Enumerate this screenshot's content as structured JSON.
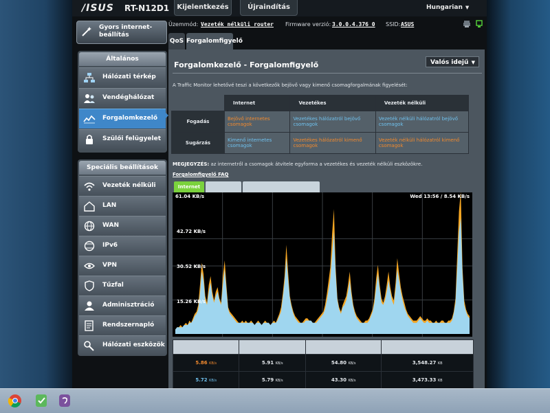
{
  "header": {
    "brand": "/ISUS",
    "model": "RT-N12D1",
    "logout_label": "Kijelentkezés",
    "reboot_label": "Újraindítás",
    "language": "Hungarian"
  },
  "sidebar": {
    "quick_setup": "Gyors internet-beállítás",
    "general_title": "Általános",
    "general_items": [
      {
        "label": "Hálózati térkép",
        "icon": "network-map-icon"
      },
      {
        "label": "Vendéghálózat",
        "icon": "guest-network-icon"
      },
      {
        "label": "Forgalomkezelő",
        "icon": "traffic-manager-icon",
        "active": true
      },
      {
        "label": "Szülői felügyelet",
        "icon": "parental-control-icon"
      }
    ],
    "advanced_title": "Speciális beállítások",
    "advanced_items": [
      {
        "label": "Vezeték nélküli",
        "icon": "wireless-icon"
      },
      {
        "label": "LAN",
        "icon": "lan-icon"
      },
      {
        "label": "WAN",
        "icon": "wan-icon"
      },
      {
        "label": "IPv6",
        "icon": "ipv6-icon"
      },
      {
        "label": "VPN",
        "icon": "vpn-icon"
      },
      {
        "label": "Tűzfal",
        "icon": "firewall-icon"
      },
      {
        "label": "Adminisztráció",
        "icon": "administration-icon"
      },
      {
        "label": "Rendszernapló",
        "icon": "system-log-icon"
      },
      {
        "label": "Hálózati eszközök",
        "icon": "network-tools-icon"
      }
    ]
  },
  "info": {
    "mode_label": "Üzemmód:",
    "mode_value": "Vezeték nélküli router",
    "firmware_label": "Firmware verzió:",
    "firmware_value": "3.0.0.4.376_0",
    "ssid_label": "SSID:",
    "ssid_value": "ASUS"
  },
  "tabs": [
    {
      "label": "QoS"
    },
    {
      "label": "Forgalomfigyelő",
      "selected": true
    }
  ],
  "page": {
    "title": "Forgalomkezelő - Forgalomfigyelő",
    "view_select": "Valós idejű",
    "description": "A Traffic Monitor lehetővé teszi a következők bejövő vagy kimenő csomagforgalmának figyelését:",
    "note_label": "MEGJEGYZÉS:",
    "note_text": " az internetről a csomagok átvitele egyforma a vezetékes és vezeték nélküli eszközökre.",
    "faq_link": "Forgalomfigyelő FAQ"
  },
  "matrix": {
    "headers": [
      "Internet",
      "Vezetékes",
      "Vezeték nélküli"
    ],
    "rows": [
      {
        "label": "Fogadás",
        "cells": [
          "Bejövő internetes csomagok",
          "Vezetékes hálózatról bejövő csomagok",
          "Vezeték nélküli hálózatról bejövő csomagok"
        ]
      },
      {
        "label": "Sugárzás",
        "cells": [
          "Kimenő internetes csomagok",
          "Vezetékes hálózatról kimenő csomagok",
          "Vezeték nélküli hálózatról kimenő csomagok"
        ]
      }
    ]
  },
  "graph_tabs": [
    {
      "label": "Internet",
      "selected": true
    },
    {
      "label": ""
    },
    {
      "label": ""
    }
  ],
  "graph": {
    "y_max_label": "61.04 KB/s",
    "y_ticks": [
      "42.72 KB/s",
      "30.52 KB/s",
      "15.26 KB/s"
    ],
    "timestamp": "Wed 13:56 / 8.54 KB/s",
    "inbound_color": "#f5a623",
    "outbound_color": "#9fd6ef"
  },
  "chart_data": {
    "type": "area",
    "title": "",
    "ylabel": "",
    "ylim": [
      0,
      61.04
    ],
    "y_ticks": [
      "15.26 KB/s",
      "30.52 KB/s",
      "42.72 KB/s",
      "61.04 KB/s"
    ],
    "series": [
      {
        "values": [
          2,
          3,
          3,
          4,
          3,
          4,
          5,
          4,
          6,
          5,
          7,
          9,
          10,
          13,
          22,
          32,
          27,
          17,
          14,
          22,
          26,
          19,
          15,
          19,
          21,
          16,
          14,
          26,
          33,
          22,
          12,
          10,
          9,
          8,
          7,
          6,
          5,
          5,
          6,
          5,
          6,
          5,
          5,
          6,
          5,
          4,
          5,
          6,
          5,
          4,
          5,
          6,
          5,
          5,
          4,
          5,
          6,
          5,
          7,
          9,
          12,
          18,
          26,
          40,
          28,
          17,
          13,
          10,
          8,
          7,
          6,
          5,
          5,
          6,
          7,
          7,
          6,
          6,
          5,
          5,
          6,
          7,
          8,
          9,
          10,
          13,
          18,
          24,
          30,
          45,
          56,
          30,
          16,
          12,
          10,
          13,
          15,
          17,
          22,
          28,
          19,
          13,
          10,
          8,
          7,
          6,
          5,
          5,
          6,
          6,
          7,
          9,
          11,
          16,
          25,
          31,
          22,
          16,
          14,
          17,
          22,
          28,
          21,
          17,
          15,
          23,
          34,
          27,
          21,
          17,
          14,
          11,
          9,
          8,
          7,
          6,
          6,
          6,
          7,
          8,
          7,
          6,
          6,
          7,
          6,
          6,
          5,
          5,
          6,
          5,
          5,
          6,
          6,
          5,
          5,
          6,
          6,
          7,
          10,
          16,
          36,
          55,
          64,
          30,
          15,
          11,
          9,
          8
        ]
      },
      {
        "values": [
          2,
          3,
          3,
          3,
          3,
          4,
          4,
          4,
          5,
          5,
          6,
          8,
          9,
          11,
          18,
          28,
          24,
          15,
          13,
          19,
          23,
          17,
          14,
          17,
          19,
          15,
          13,
          22,
          29,
          20,
          11,
          9,
          8,
          7,
          6,
          5,
          5,
          5,
          5,
          5,
          5,
          5,
          5,
          5,
          5,
          4,
          5,
          5,
          5,
          4,
          5,
          5,
          5,
          5,
          4,
          5,
          5,
          5,
          6,
          8,
          10,
          16,
          23,
          34,
          25,
          16,
          12,
          9,
          7,
          6,
          5,
          5,
          5,
          5,
          6,
          6,
          6,
          6,
          5,
          5,
          5,
          6,
          7,
          8,
          9,
          11,
          15,
          20,
          25,
          36,
          46,
          27,
          15,
          11,
          9,
          12,
          13,
          15,
          19,
          24,
          17,
          12,
          9,
          7,
          6,
          5,
          5,
          5,
          5,
          5,
          6,
          8,
          10,
          14,
          21,
          27,
          20,
          14,
          13,
          15,
          19,
          24,
          19,
          15,
          13,
          20,
          29,
          24,
          19,
          15,
          12,
          10,
          8,
          7,
          6,
          5,
          5,
          5,
          6,
          7,
          6,
          5,
          5,
          6,
          5,
          5,
          5,
          5,
          5,
          5,
          5,
          5,
          5,
          5,
          5,
          5,
          5,
          6,
          9,
          14,
          30,
          46,
          52,
          27,
          13,
          10,
          8,
          7
        ]
      }
    ]
  },
  "stats": {
    "headers": [
      "",
      "",
      "",
      ""
    ],
    "rows": [
      {
        "values": [
          "5.86",
          "5.91",
          "54.80",
          "3,548.27"
        ],
        "units": [
          "KB/s",
          "KB/s",
          "KB/s",
          "KB"
        ],
        "accent": "o"
      },
      {
        "values": [
          "5.72",
          "5.79",
          "43.30",
          "3,473.33"
        ],
        "units": [
          "KB/s",
          "KB/s",
          "KB/s",
          "KB"
        ],
        "accent": "b"
      }
    ]
  }
}
